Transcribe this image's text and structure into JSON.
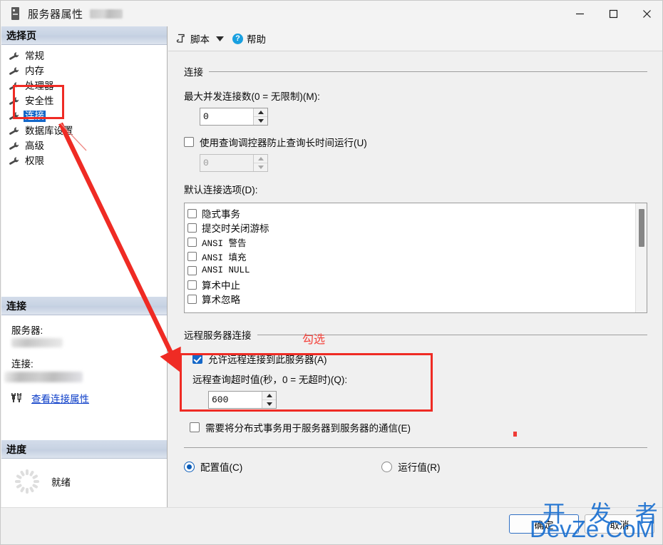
{
  "window": {
    "title": "服务器属性",
    "icon": "server-icon",
    "minimize_label": "最小化",
    "maximize_label": "最大化",
    "close_label": "关闭"
  },
  "sidebar": {
    "select_page_header": "选择页",
    "items": [
      {
        "label": "常规",
        "icon": "wrench-icon",
        "selected": false
      },
      {
        "label": "内存",
        "icon": "wrench-icon",
        "selected": false
      },
      {
        "label": "处理器",
        "icon": "wrench-icon",
        "selected": false
      },
      {
        "label": "安全性",
        "icon": "wrench-icon",
        "selected": false
      },
      {
        "label": "连接",
        "icon": "wrench-icon",
        "selected": true
      },
      {
        "label": "数据库设置",
        "icon": "wrench-icon",
        "selected": false
      },
      {
        "label": "高级",
        "icon": "wrench-icon",
        "selected": false
      },
      {
        "label": "权限",
        "icon": "wrench-icon",
        "selected": false
      }
    ],
    "connection": {
      "header": "连接",
      "server_label": "服务器:",
      "connection_label": "连接:",
      "view_properties_link": "查看连接属性",
      "link_icon": "connection-icon"
    },
    "progress": {
      "header": "进度",
      "status": "就绪",
      "spinner_icon": "loading-spinner-icon"
    }
  },
  "toolbar": {
    "script_label": "脚本",
    "script_icon": "script-icon",
    "dropdown_icon": "chevron-down-icon",
    "help_label": "帮助",
    "help_icon": "help-circle-icon",
    "help_glyph": "?"
  },
  "main": {
    "connections_group": "连接",
    "max_connections_label": "最大并发连接数(0 = 无限制)(M):",
    "max_connections_value": "0",
    "query_governor_label": "使用查询调控器防止查询长时间运行(U)",
    "query_governor_checked": false,
    "query_governor_value": "0",
    "default_conn_options_label": "默认连接选项(D):",
    "options": [
      {
        "label": "隐式事务",
        "checked": false,
        "mono": false
      },
      {
        "label": "提交时关闭游标",
        "checked": false,
        "mono": false
      },
      {
        "label": "ANSI 警告",
        "checked": false,
        "mono": true
      },
      {
        "label": "ANSI 填充",
        "checked": false,
        "mono": true
      },
      {
        "label": "ANSI NULL",
        "checked": false,
        "mono": true
      },
      {
        "label": "算术中止",
        "checked": false,
        "mono": false
      },
      {
        "label": "算术忽略",
        "checked": false,
        "mono": false
      }
    ],
    "remote_group": "远程服务器连接",
    "allow_remote_label": "允许远程连接到此服务器(A)",
    "allow_remote_checked": true,
    "remote_timeout_label": "远程查询超时值(秒，0 = 无超时)(Q):",
    "remote_timeout_value": "600",
    "require_dtc_label": "需要将分布式事务用于服务器到服务器的通信(E)",
    "require_dtc_checked": false,
    "radio_configured": "配置值(C)",
    "radio_running": "运行值(R)",
    "radio_selected": "配置值(C)"
  },
  "footer": {
    "ok_label": "确定",
    "cancel_label": "取消"
  },
  "annotations": {
    "gouxuan_note": "勾选",
    "highlight_color": "#ef2b24",
    "note_color": "#f4433c",
    "arrow_color": "#ef2b24"
  },
  "watermark": {
    "line1": "开 发 者",
    "line2": "DevZe.CoM",
    "color": "#1a6fd0"
  }
}
